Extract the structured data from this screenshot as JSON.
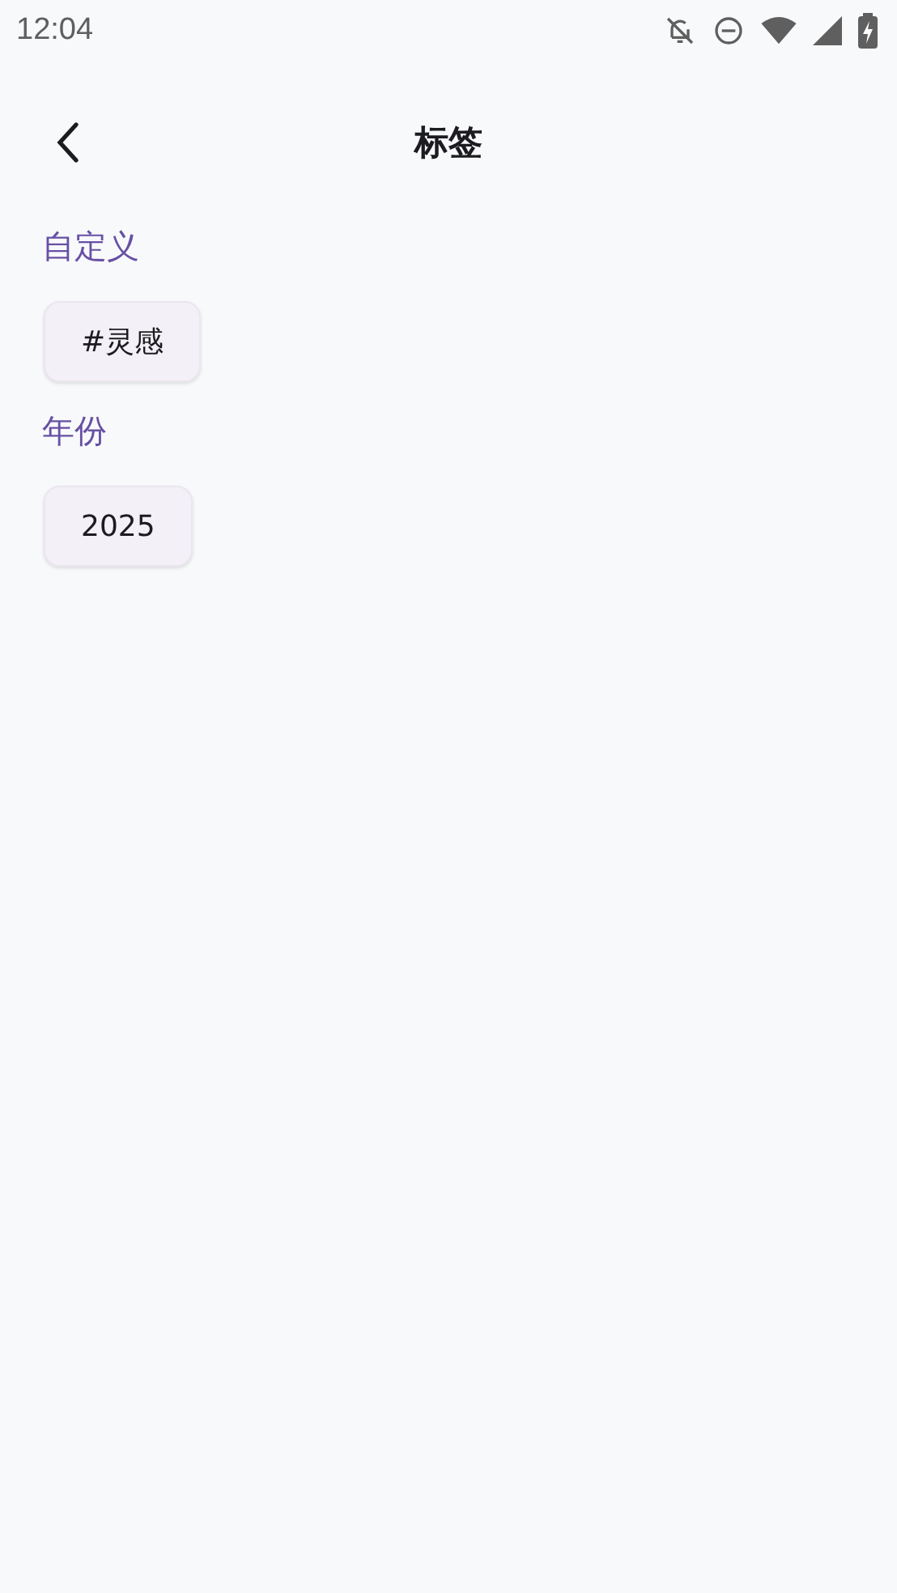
{
  "status_bar": {
    "time": "12:04"
  },
  "header": {
    "title": "标签"
  },
  "sections": [
    {
      "title": "自定义",
      "tags": [
        "#灵感"
      ]
    },
    {
      "title": "年份",
      "tags": [
        "2025"
      ]
    }
  ]
}
